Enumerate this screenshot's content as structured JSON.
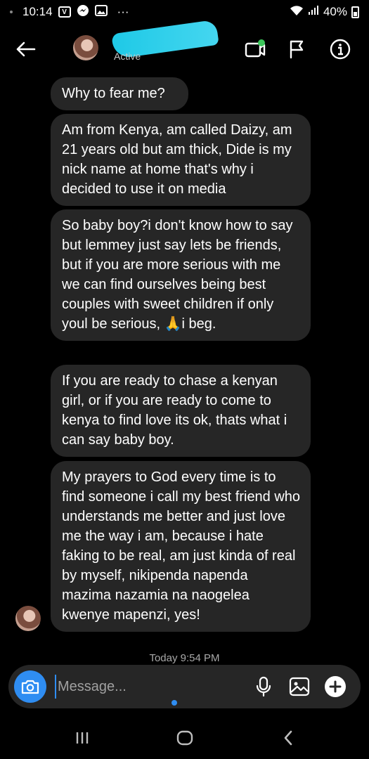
{
  "status_bar": {
    "time": "10:14",
    "battery": "40%",
    "overflow": "···"
  },
  "header": {
    "active_label": "Active"
  },
  "messages": [
    "Why to fear me?",
    "Am from Kenya, am called Daizy, am 21 years old but am thick, Dide is my nick name at home that's why i decided to use it on media",
    "So baby boy?i don't know how to say but lemmey just say lets be friends, but if you are more serious with me we can find ourselves being best couples with sweet children if only youl be serious, 🙏i beg.",
    "If you are ready to chase a kenyan girl, or if you are ready to come to kenya to find love its ok, thats what i can say baby boy.",
    "My prayers to God every time is to find someone i call my best friend who understands me better and just love me the way i am, because i hate faking to be real, am just kinda of real by myself, nikipenda napenda mazima nazamia na naogelea kwenye mapenzi, yes!"
  ],
  "timestamp": "Today 9:54 PM",
  "composer": {
    "placeholder": "Message..."
  },
  "colors": {
    "accent": "#2f8df2",
    "bubble": "#262626",
    "active_dot": "#3cc75b",
    "redaction": "#1ec9e6"
  }
}
